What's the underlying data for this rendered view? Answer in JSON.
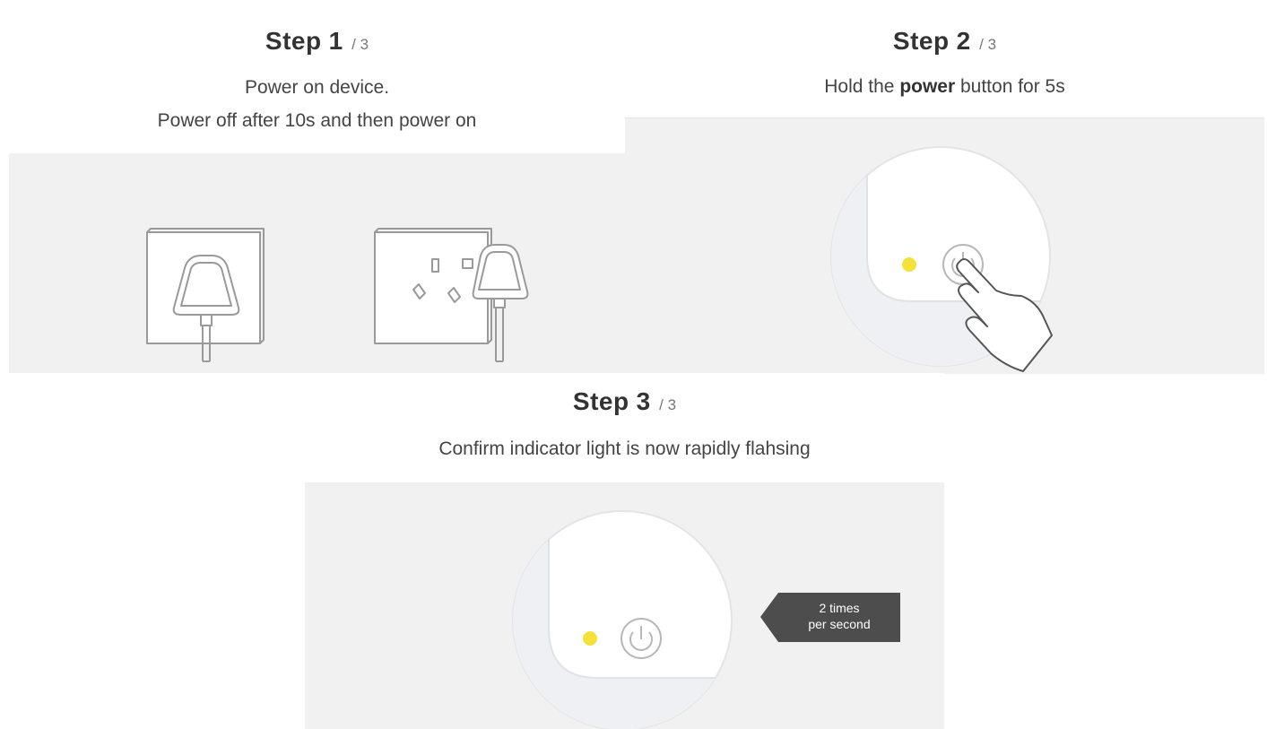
{
  "step1": {
    "word": "Step",
    "number": "1",
    "total": "/ 3",
    "line1": "Power on device.",
    "line2": "Power off after 10s and then power on"
  },
  "step2": {
    "word": "Step",
    "number": "2",
    "total": "/ 3",
    "desc_pre": "Hold the ",
    "desc_bold": "power",
    "desc_post": " button for 5s"
  },
  "step3": {
    "word": "Step",
    "number": "3",
    "total": "/ 3",
    "desc": "Confirm indicator light is now rapidly flahsing",
    "callout_line1": "2 times",
    "callout_line2": "per second"
  },
  "colors": {
    "panel_bg": "#f1f1f1",
    "indicator_yellow": "#f4e13a",
    "line_gray": "#9a9a9a",
    "callout_bg": "#4d4d4d"
  },
  "icons": [
    "plug-in-socket-icon",
    "plug-out-socket-icon",
    "indicator-light-icon",
    "power-button-icon",
    "pointing-hand-icon",
    "arrow-callout-icon"
  ]
}
